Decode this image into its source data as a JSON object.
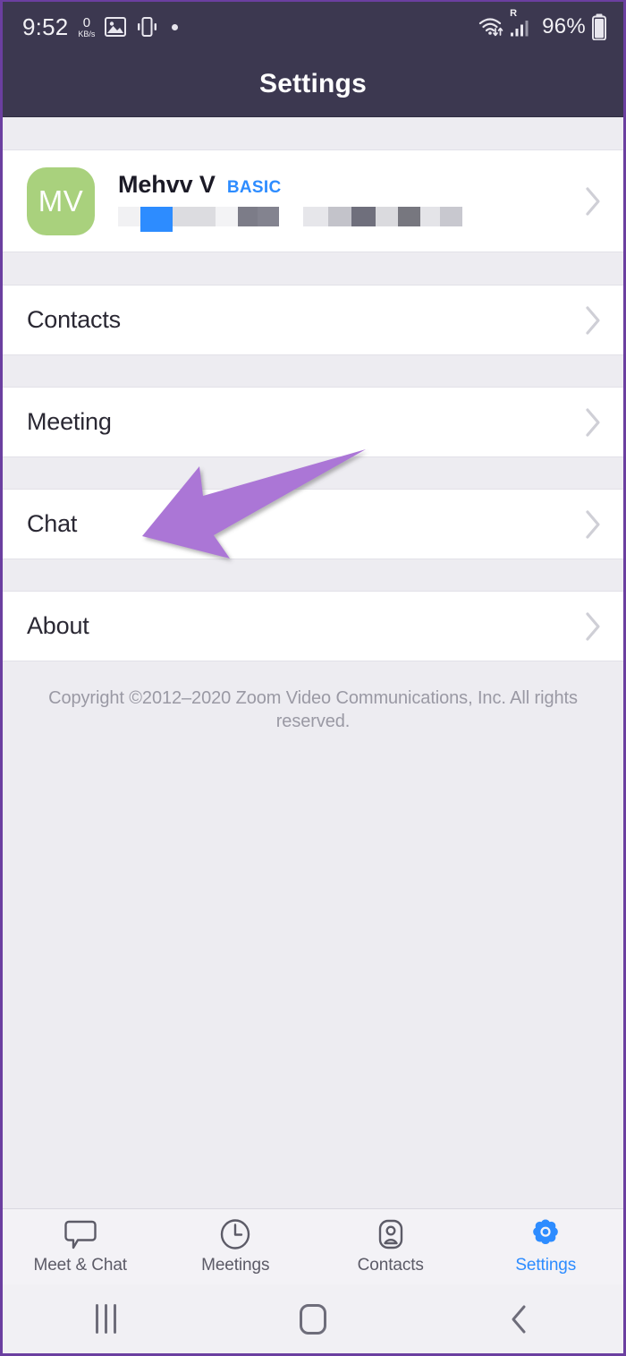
{
  "status_bar": {
    "time": "9:52",
    "network_speed_value": "0",
    "network_speed_unit": "KB/s",
    "icons": [
      "image-icon",
      "vibrate-icon",
      "dot-icon",
      "wifi-icon",
      "roaming-signal-icon",
      "battery-icon"
    ],
    "roaming_label": "R",
    "battery_percent": "96%",
    "background_color": "#3c3850"
  },
  "header": {
    "title": "Settings",
    "background_color": "#3c3850",
    "text_color": "#ffffff"
  },
  "profile": {
    "initials": "MV",
    "name": "Mehvv V",
    "plan": "BASIC",
    "plan_color": "#2d8cff",
    "avatar_color": "#a9d17d",
    "email_redacted": true,
    "chevron": "chevron-right-icon"
  },
  "menu": {
    "items": [
      {
        "label": "Contacts",
        "chevron": "chevron-right-icon"
      },
      {
        "label": "Meeting",
        "chevron": "chevron-right-icon"
      },
      {
        "label": "Chat",
        "chevron": "chevron-right-icon"
      },
      {
        "label": "About",
        "chevron": "chevron-right-icon"
      }
    ]
  },
  "footer": {
    "copyright": "Copyright ©2012–2020 Zoom Video Communications, Inc. All rights reserved."
  },
  "annotation": {
    "type": "arrow",
    "color": "#ab76d6",
    "points_to": "Meeting"
  },
  "tab_bar": {
    "items": [
      {
        "label": "Meet & Chat",
        "icon": "chat-bubble-icon",
        "active": false
      },
      {
        "label": "Meetings",
        "icon": "clock-icon",
        "active": false
      },
      {
        "label": "Contacts",
        "icon": "person-icon",
        "active": false
      },
      {
        "label": "Settings",
        "icon": "gear-icon",
        "active": true
      }
    ],
    "active_color": "#2d8cff",
    "inactive_color": "#5c5b67"
  },
  "android_nav": {
    "recents_label": "recents-icon",
    "home_label": "home-icon",
    "back_label": "back-icon"
  }
}
